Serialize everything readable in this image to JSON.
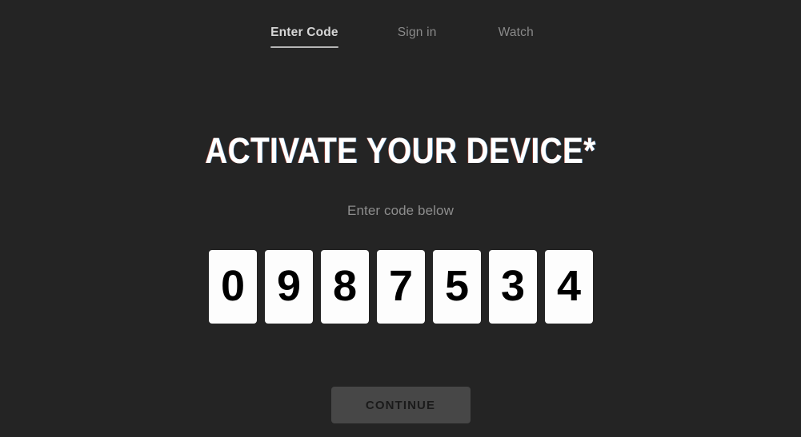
{
  "theme": {
    "background": "#242424",
    "active_tab_color": "#d6d6d6",
    "inactive_tab_color": "#8a8a8a",
    "code_box_background": "#fdfdfd",
    "code_digit_color": "#000000",
    "button_background": "#474747",
    "button_text_color": "#1a1a1a",
    "headline_color": "#ffffff",
    "subtitle_color": "#8d8d8d"
  },
  "nav": {
    "tabs": [
      {
        "label": "Enter Code",
        "active": true
      },
      {
        "label": "Sign in",
        "active": false
      },
      {
        "label": "Watch",
        "active": false
      }
    ]
  },
  "main": {
    "headline": "ACTIVATE YOUR DEVICE*",
    "subtitle": "Enter code below",
    "code": {
      "digits": [
        "0",
        "9",
        "8",
        "7",
        "5",
        "3",
        "4"
      ],
      "length": 7,
      "value": "0987534"
    },
    "continue_label": "CONTINUE"
  }
}
